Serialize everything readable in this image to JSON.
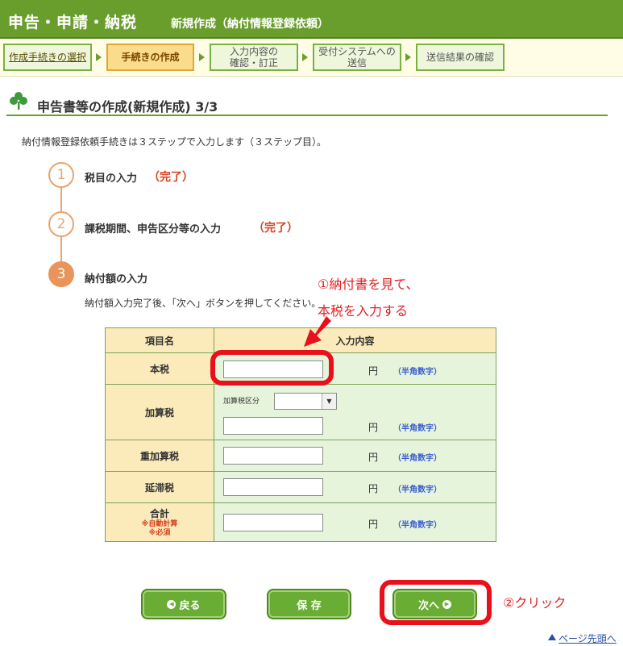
{
  "header": {
    "title": "申告・申請・納税",
    "subtitle": "新規作成（納付情報登録依頼）"
  },
  "steps": [
    {
      "label": "作成手続きの選択"
    },
    {
      "label": "手続きの作成"
    },
    {
      "label1": "入力内容の",
      "label2": "確認・訂正"
    },
    {
      "label1": "受付システムへの",
      "label2": "送信"
    },
    {
      "label": "送信結果の確認"
    }
  ],
  "section": {
    "title": "申告書等の作成(新規作成) 3/3",
    "intro": "納付情報登録依頼手続きは３ステップで入力します（３ステップ目）。"
  },
  "progress": [
    {
      "num": "1",
      "label": "税目の入力",
      "status": "（完了）"
    },
    {
      "num": "2",
      "label": "課税期間、申告区分等の入力",
      "status": "（完了）"
    },
    {
      "num": "3",
      "label": "納付額の入力"
    }
  ],
  "instruction": "納付額入力完了後、「次へ」ボタンを押してください。",
  "table": {
    "col1": "項目名",
    "col2": "入力内容",
    "rows": {
      "honzei": "本税",
      "kasanzei": "加算税",
      "jukasanzei": "重加算税",
      "entaizei": "延滞税",
      "gokei": "合計"
    },
    "gokei_note1": "※自動計算",
    "gokei_note2": "※必須",
    "kasanzei_kubun_label": "加算税区分",
    "yen": "円",
    "hint": "（半角数字）"
  },
  "annotations": {
    "a1_line1": "①納付書を見て、",
    "a1_line2": "本税を入力する",
    "a2": "②クリック"
  },
  "buttons": {
    "back": "戻る",
    "save": "保 存",
    "next": "次へ"
  },
  "page_top": "ページ先頭へ",
  "colors": {
    "brand_green": "#6a9e2c",
    "accent_orange": "#e8945a",
    "done_red": "#d6401f",
    "annotation_red": "#e8101b"
  }
}
